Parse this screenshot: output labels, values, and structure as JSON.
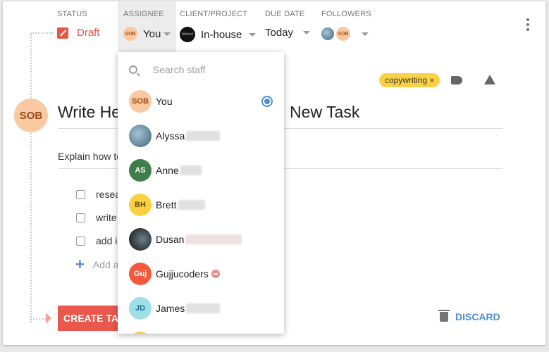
{
  "header": {
    "status": {
      "label": "STATUS",
      "value": "Draft"
    },
    "assignee": {
      "label": "ASSIGNEE",
      "value": "You",
      "avatar_initials": "SOB"
    },
    "client": {
      "label": "CLIENT/PROJECT",
      "value": "In-house",
      "avatar_text": "Artfood"
    },
    "due": {
      "label": "DUE DATE",
      "value": "Today"
    },
    "followers": {
      "label": "FOLLOWERS",
      "avatar_initials": "SOB"
    }
  },
  "task": {
    "author_initials": "SOB",
    "tag": "copywriting ×",
    "title_start": "Write He",
    "title_end": "New Task",
    "description": "Explain how to",
    "checklist": [
      "resea",
      "write",
      "add i"
    ],
    "add_item_label": "Add a",
    "create_label": "CREATE TASK",
    "discard_label": "DISCARD"
  },
  "dropdown": {
    "search_placeholder": "Search staff",
    "items": [
      {
        "initials": "SOB",
        "name": "You",
        "selected": true,
        "bg": "#f9c9a2",
        "fg": "#9a4a16"
      },
      {
        "initials": "",
        "name": "Alyssa",
        "bg": "#5b8aa6",
        "fg": "#ffffff"
      },
      {
        "initials": "AS",
        "name": "Anne",
        "bg": "#3f7d4a",
        "fg": "#ffffff"
      },
      {
        "initials": "BH",
        "name": "Brett",
        "bg": "#fbd143",
        "fg": "#6b5400"
      },
      {
        "initials": "",
        "name": "Dusan",
        "bg": "#1c1c1c",
        "fg": "#ffffff"
      },
      {
        "initials": "Guj",
        "name": "Gujjucoders",
        "bg": "#f25a3b",
        "fg": "#ffffff"
      },
      {
        "initials": "JD",
        "name": "James",
        "bg": "#9ee0e6",
        "fg": "#1d6fa0"
      }
    ]
  },
  "colors": {
    "accent": "#4f8fd0",
    "danger": "#e9574d",
    "tag": "#fbd143"
  }
}
